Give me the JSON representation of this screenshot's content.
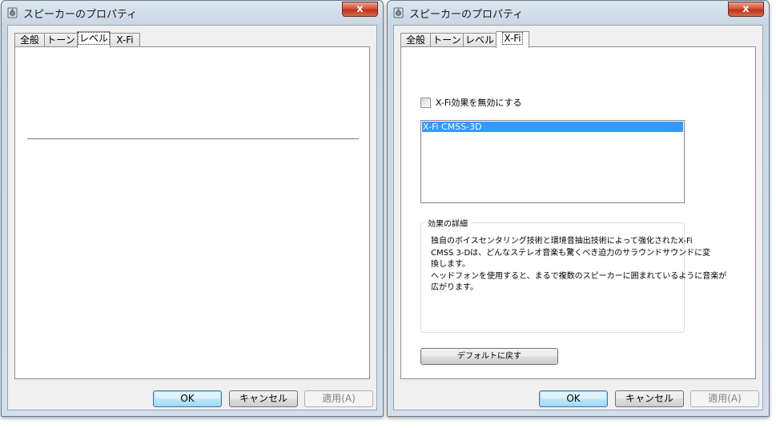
{
  "left_window": {
    "title": "スピーカーのプロパティ",
    "close_label": "x",
    "tabs": [
      {
        "label": "全般"
      },
      {
        "label": "トーン"
      },
      {
        "label": "レベル"
      },
      {
        "label": "X-Fi"
      }
    ],
    "active_tab": "レベル",
    "buttons": {
      "ok": "OK",
      "cancel": "キャンセル",
      "apply": "適用(A)"
    }
  },
  "right_window": {
    "title": "スピーカーのプロパティ",
    "close_label": "x",
    "tabs": [
      {
        "label": "全般"
      },
      {
        "label": "トーン"
      },
      {
        "label": "レベル"
      },
      {
        "label": "X-Fi"
      }
    ],
    "active_tab": "X-Fi",
    "disable_checkbox": {
      "label": "X-Fi効果を無効にする",
      "checked": false
    },
    "effect_list": [
      {
        "label": "X-Fi CMSS-3D",
        "selected": true
      }
    ],
    "details": {
      "title": "効果の詳細",
      "lines": [
        "独自のボイスセンタリング技術と環境音抽出技術によって強化されたX-Fi",
        "CMSS 3-Dは、どんなステレオ音楽も驚くべき迫力のサラウンドサウンドに変",
        "換します。",
        "ヘッドフォンを使用すると、まるで複数のスピーカーに囲まれているように音楽が",
        "広がります。"
      ]
    },
    "reset_button": "デフォルトに戻す",
    "buttons": {
      "ok": "OK",
      "cancel": "キャンセル",
      "apply": "適用(A)"
    }
  },
  "colors": {
    "selection": "#3399ff",
    "close_button": "#c43c1f",
    "window_frame": "#c9d7e4"
  }
}
